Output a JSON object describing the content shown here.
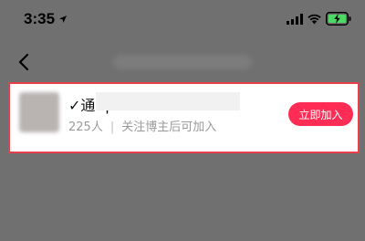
{
  "status_bar": {
    "time": "3:35",
    "location_icon": "location-arrow-icon",
    "signal_icon": "cellular-signal-icon",
    "wifi_icon": "wifi-icon",
    "battery_icon": "battery-charging-icon",
    "battery_color": "#4cd964"
  },
  "nav": {
    "back_icon": "chevron-left-icon"
  },
  "group": {
    "name_prefix": "✓通 q",
    "member_count": "225人",
    "separator": "|",
    "join_condition": "关注博主后可加入",
    "join_label": "立即加入",
    "accent_color": "#ff2c55",
    "highlight_color": "#e8404a"
  }
}
